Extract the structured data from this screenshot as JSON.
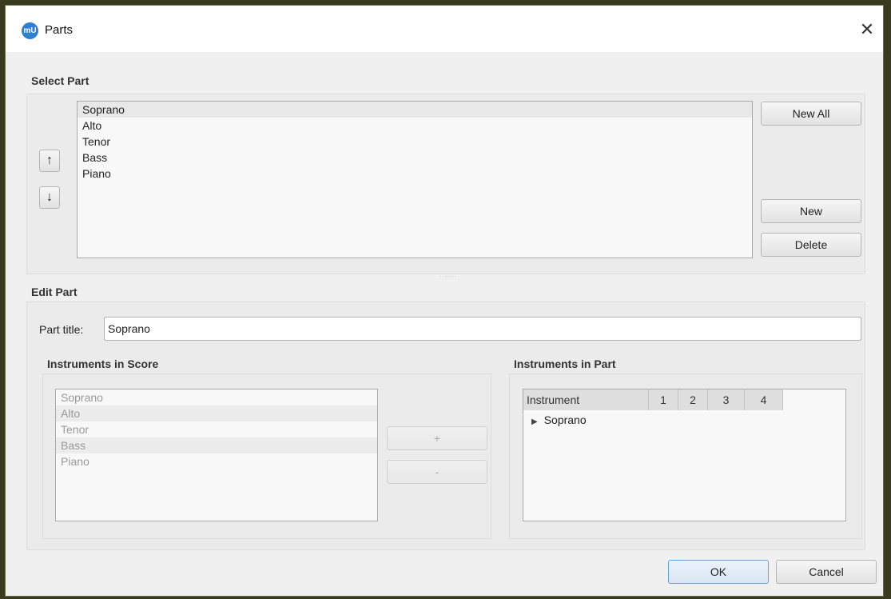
{
  "window": {
    "title": "Parts",
    "app_icon": "musescore-logo-icon",
    "app_icon_text": "mU",
    "close_label": "✕"
  },
  "select_part": {
    "heading": "Select Part",
    "items": [
      "Soprano",
      "Alto",
      "Tenor",
      "Bass",
      "Piano"
    ],
    "selected": "Soprano",
    "move_up_label": "↑",
    "move_down_label": "↓",
    "new_all_label": "New All",
    "new_label": "New",
    "delete_label": "Delete"
  },
  "edit_part": {
    "heading": "Edit Part",
    "part_title_label": "Part title:",
    "part_title_value": "Soprano",
    "instruments_in_score": {
      "heading": "Instruments in Score",
      "items": [
        "Soprano",
        "Alto",
        "Tenor",
        "Bass",
        "Piano"
      ]
    },
    "add_label": "+",
    "remove_label": "-",
    "instruments_in_part": {
      "heading": "Instruments in Part",
      "columns": [
        "Instrument",
        "1",
        "2",
        "3",
        "4"
      ],
      "rows": [
        "Soprano"
      ]
    }
  },
  "footer": {
    "ok_label": "OK",
    "cancel_label": "Cancel"
  },
  "colors": {
    "accent": "#2f7fd1",
    "window_bg": "#f0f0f0",
    "ok_border": "#6aa2d8"
  }
}
